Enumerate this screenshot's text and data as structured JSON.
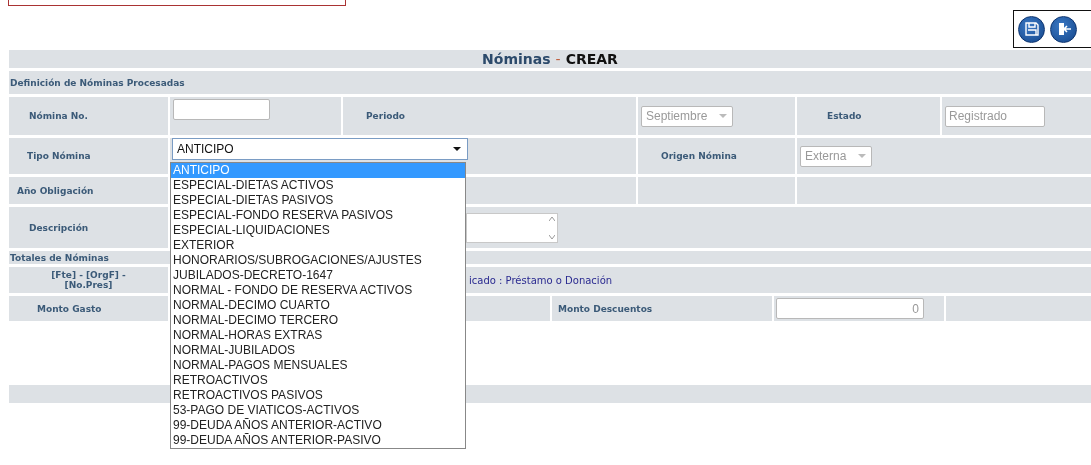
{
  "title": {
    "name": "Nóminas",
    "separator": "-",
    "action": "CREAR"
  },
  "section": "Definición de Nóminas Procesadas",
  "nomina_no": {
    "label": "Nómina No."
  },
  "periodo": {
    "label": "Periodo",
    "value": "Septiembre",
    "disabled": true
  },
  "estado": {
    "label": "Estado",
    "value": "Registrado",
    "disabled": true
  },
  "tipo_nomina": {
    "label": "Tipo Nómina",
    "value": "ANTICIPO",
    "expanded": true,
    "options": [
      {
        "label": "ANTICIPO",
        "selected": true
      },
      {
        "label": "ESPECIAL-DIETAS ACTIVOS",
        "selected": false
      },
      {
        "label": "ESPECIAL-DIETAS PASIVOS",
        "selected": false
      },
      {
        "label": "ESPECIAL-FONDO RESERVA PASIVOS",
        "selected": false
      },
      {
        "label": "ESPECIAL-LIQUIDACIONES",
        "selected": false
      },
      {
        "label": "EXTERIOR",
        "selected": false
      },
      {
        "label": "HONORARIOS/SUBROGACIONES/AJUSTES",
        "selected": false
      },
      {
        "label": "JUBILADOS-DECRETO-1647",
        "selected": false
      },
      {
        "label": "NORMAL - FONDO DE RESERVA ACTIVOS",
        "selected": false
      },
      {
        "label": "NORMAL-DECIMO CUARTO",
        "selected": false
      },
      {
        "label": "NORMAL-DECIMO TERCERO",
        "selected": false
      },
      {
        "label": "NORMAL-HORAS EXTRAS",
        "selected": false
      },
      {
        "label": "NORMAL-JUBILADOS",
        "selected": false
      },
      {
        "label": "NORMAL-PAGOS MENSUALES",
        "selected": false
      },
      {
        "label": "RETROACTIVOS",
        "selected": false
      },
      {
        "label": "RETROACTIVOS PASIVOS",
        "selected": false
      },
      {
        "label": "53-PAGO DE VIATICOS-ACTIVOS",
        "selected": false
      },
      {
        "label": "99-DEUDA AÑOS ANTERIOR-ACTIVO",
        "selected": false
      },
      {
        "label": "99-DEUDA AÑOS ANTERIOR-PASIVO",
        "selected": false
      }
    ]
  },
  "origen_nomina": {
    "label": "Origen Nómina",
    "value": "Externa",
    "disabled": true
  },
  "anio_obligacion": {
    "label": "Año Obligación"
  },
  "descripcion": {
    "label": "Descripción"
  },
  "totales": {
    "title": "Totales de Nóminas",
    "fuente_label": "[Fte] - [OrgF] - [No.Pres]",
    "fuente_value": "icado : Préstamo o Donación",
    "monto_gasto": {
      "label": "Monto Gasto"
    },
    "monto_descuentos": {
      "label": "Monto Descuentos",
      "value": "0",
      "disabled": true
    }
  }
}
